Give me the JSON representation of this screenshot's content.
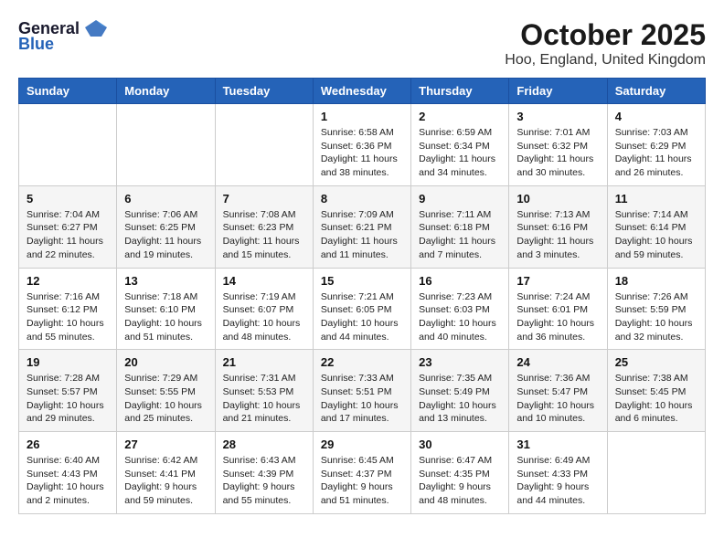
{
  "header": {
    "logo_general": "General",
    "logo_blue": "Blue",
    "month_title": "October 2025",
    "location": "Hoo, England, United Kingdom"
  },
  "days_of_week": [
    "Sunday",
    "Monday",
    "Tuesday",
    "Wednesday",
    "Thursday",
    "Friday",
    "Saturday"
  ],
  "weeks": [
    [
      {
        "day": "",
        "info": ""
      },
      {
        "day": "",
        "info": ""
      },
      {
        "day": "",
        "info": ""
      },
      {
        "day": "1",
        "info": "Sunrise: 6:58 AM\nSunset: 6:36 PM\nDaylight: 11 hours\nand 38 minutes."
      },
      {
        "day": "2",
        "info": "Sunrise: 6:59 AM\nSunset: 6:34 PM\nDaylight: 11 hours\nand 34 minutes."
      },
      {
        "day": "3",
        "info": "Sunrise: 7:01 AM\nSunset: 6:32 PM\nDaylight: 11 hours\nand 30 minutes."
      },
      {
        "day": "4",
        "info": "Sunrise: 7:03 AM\nSunset: 6:29 PM\nDaylight: 11 hours\nand 26 minutes."
      }
    ],
    [
      {
        "day": "5",
        "info": "Sunrise: 7:04 AM\nSunset: 6:27 PM\nDaylight: 11 hours\nand 22 minutes."
      },
      {
        "day": "6",
        "info": "Sunrise: 7:06 AM\nSunset: 6:25 PM\nDaylight: 11 hours\nand 19 minutes."
      },
      {
        "day": "7",
        "info": "Sunrise: 7:08 AM\nSunset: 6:23 PM\nDaylight: 11 hours\nand 15 minutes."
      },
      {
        "day": "8",
        "info": "Sunrise: 7:09 AM\nSunset: 6:21 PM\nDaylight: 11 hours\nand 11 minutes."
      },
      {
        "day": "9",
        "info": "Sunrise: 7:11 AM\nSunset: 6:18 PM\nDaylight: 11 hours\nand 7 minutes."
      },
      {
        "day": "10",
        "info": "Sunrise: 7:13 AM\nSunset: 6:16 PM\nDaylight: 11 hours\nand 3 minutes."
      },
      {
        "day": "11",
        "info": "Sunrise: 7:14 AM\nSunset: 6:14 PM\nDaylight: 10 hours\nand 59 minutes."
      }
    ],
    [
      {
        "day": "12",
        "info": "Sunrise: 7:16 AM\nSunset: 6:12 PM\nDaylight: 10 hours\nand 55 minutes."
      },
      {
        "day": "13",
        "info": "Sunrise: 7:18 AM\nSunset: 6:10 PM\nDaylight: 10 hours\nand 51 minutes."
      },
      {
        "day": "14",
        "info": "Sunrise: 7:19 AM\nSunset: 6:07 PM\nDaylight: 10 hours\nand 48 minutes."
      },
      {
        "day": "15",
        "info": "Sunrise: 7:21 AM\nSunset: 6:05 PM\nDaylight: 10 hours\nand 44 minutes."
      },
      {
        "day": "16",
        "info": "Sunrise: 7:23 AM\nSunset: 6:03 PM\nDaylight: 10 hours\nand 40 minutes."
      },
      {
        "day": "17",
        "info": "Sunrise: 7:24 AM\nSunset: 6:01 PM\nDaylight: 10 hours\nand 36 minutes."
      },
      {
        "day": "18",
        "info": "Sunrise: 7:26 AM\nSunset: 5:59 PM\nDaylight: 10 hours\nand 32 minutes."
      }
    ],
    [
      {
        "day": "19",
        "info": "Sunrise: 7:28 AM\nSunset: 5:57 PM\nDaylight: 10 hours\nand 29 minutes."
      },
      {
        "day": "20",
        "info": "Sunrise: 7:29 AM\nSunset: 5:55 PM\nDaylight: 10 hours\nand 25 minutes."
      },
      {
        "day": "21",
        "info": "Sunrise: 7:31 AM\nSunset: 5:53 PM\nDaylight: 10 hours\nand 21 minutes."
      },
      {
        "day": "22",
        "info": "Sunrise: 7:33 AM\nSunset: 5:51 PM\nDaylight: 10 hours\nand 17 minutes."
      },
      {
        "day": "23",
        "info": "Sunrise: 7:35 AM\nSunset: 5:49 PM\nDaylight: 10 hours\nand 13 minutes."
      },
      {
        "day": "24",
        "info": "Sunrise: 7:36 AM\nSunset: 5:47 PM\nDaylight: 10 hours\nand 10 minutes."
      },
      {
        "day": "25",
        "info": "Sunrise: 7:38 AM\nSunset: 5:45 PM\nDaylight: 10 hours\nand 6 minutes."
      }
    ],
    [
      {
        "day": "26",
        "info": "Sunrise: 6:40 AM\nSunset: 4:43 PM\nDaylight: 10 hours\nand 2 minutes."
      },
      {
        "day": "27",
        "info": "Sunrise: 6:42 AM\nSunset: 4:41 PM\nDaylight: 9 hours\nand 59 minutes."
      },
      {
        "day": "28",
        "info": "Sunrise: 6:43 AM\nSunset: 4:39 PM\nDaylight: 9 hours\nand 55 minutes."
      },
      {
        "day": "29",
        "info": "Sunrise: 6:45 AM\nSunset: 4:37 PM\nDaylight: 9 hours\nand 51 minutes."
      },
      {
        "day": "30",
        "info": "Sunrise: 6:47 AM\nSunset: 4:35 PM\nDaylight: 9 hours\nand 48 minutes."
      },
      {
        "day": "31",
        "info": "Sunrise: 6:49 AM\nSunset: 4:33 PM\nDaylight: 9 hours\nand 44 minutes."
      },
      {
        "day": "",
        "info": ""
      }
    ]
  ]
}
